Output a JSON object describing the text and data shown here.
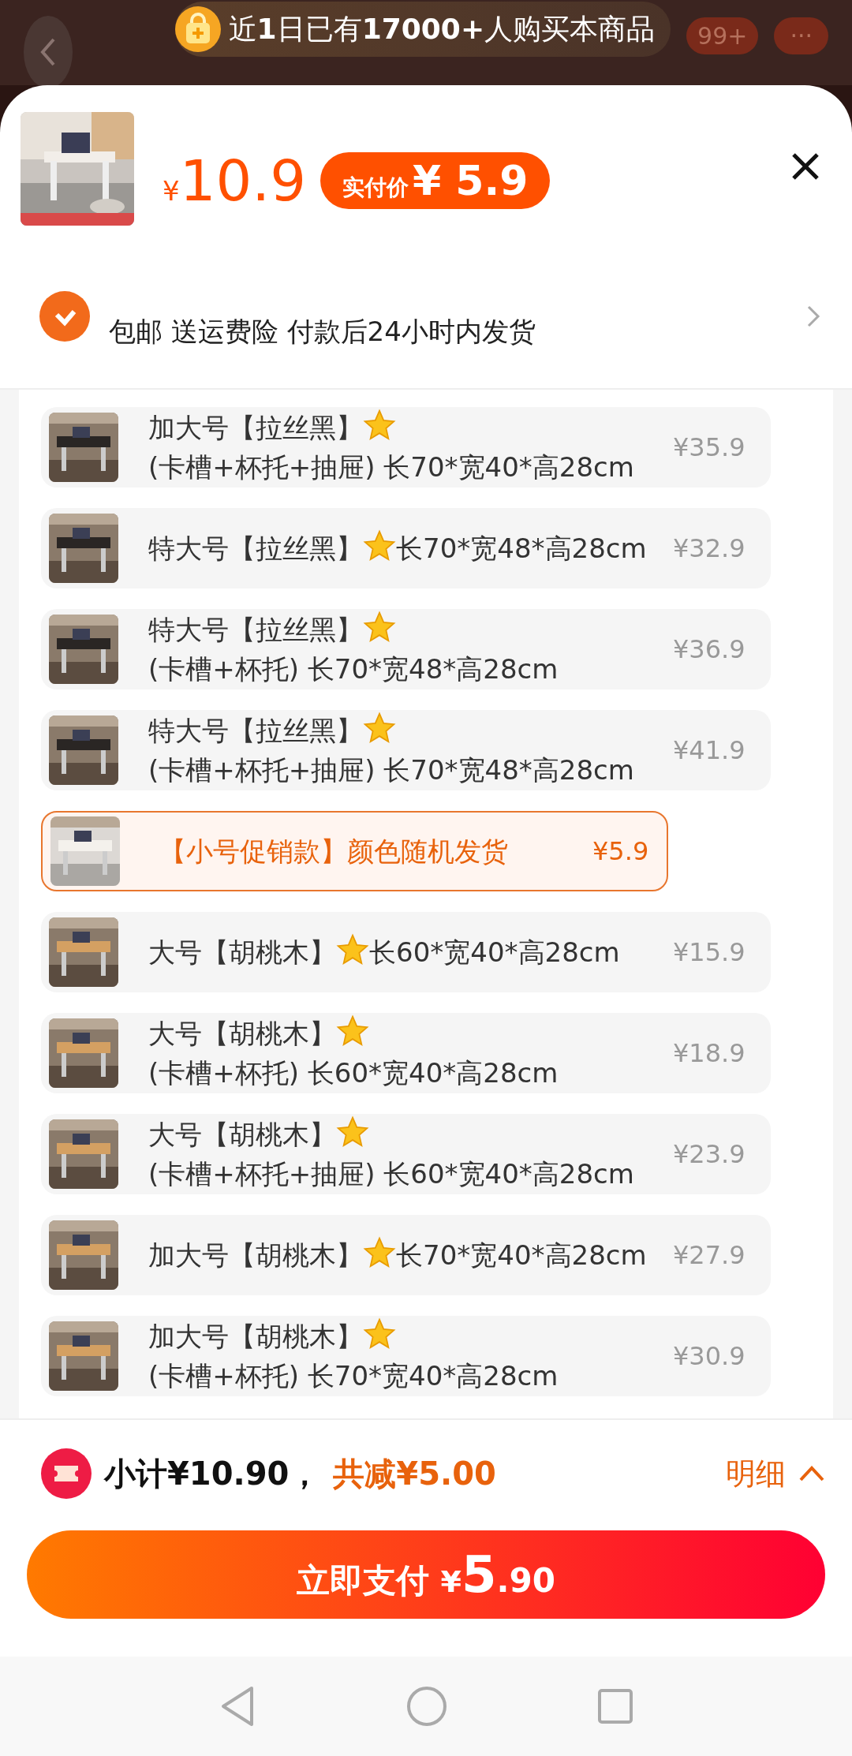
{
  "banner": {
    "text": "近**1**日已有**17000+**人购买本商品"
  },
  "background_header": {
    "cart_badge": "99+",
    "more": "···"
  },
  "product": {
    "price_symbol": "¥",
    "price": "10.9",
    "paid_label": "实付价",
    "paid_price": "¥ 5.9"
  },
  "shipping": {
    "text": "包邮 送运费险 付款后24小时内发货"
  },
  "options": [
    {
      "name": "加大号【拉丝黑】",
      "spec": "(卡槽+杯托+抽屉) 长70*宽40*高28cm",
      "price": "¥35.9",
      "selected": false
    },
    {
      "name": "特大号【拉丝黑】",
      "spec": "长70*宽48*高28cm",
      "price": "¥32.9",
      "selected": false
    },
    {
      "name": "特大号【拉丝黑】",
      "spec": "(卡槽+杯托) 长70*宽48*高28cm",
      "price": "¥36.9",
      "selected": false
    },
    {
      "name": "特大号【拉丝黑】",
      "spec": "(卡槽+杯托+抽屉) 长70*宽48*高28cm",
      "price": "¥41.9",
      "selected": false
    },
    {
      "name": "【小号促销款】颜色随机发货",
      "price": "¥5.9",
      "selected": true
    },
    {
      "name": "大号【胡桃木】",
      "spec": "长60*宽40*高28cm",
      "price": "¥15.9",
      "selected": false
    },
    {
      "name": "大号【胡桃木】",
      "spec": "(卡槽+杯托) 长60*宽40*高28cm",
      "price": "¥18.9",
      "selected": false
    },
    {
      "name": "大号【胡桃木】",
      "spec": "(卡槽+杯托+抽屉) 长60*宽40*高28cm",
      "price": "¥23.9",
      "selected": false
    },
    {
      "name": "加大号【胡桃木】",
      "spec": "长70*宽40*高28cm",
      "price": "¥27.9",
      "selected": false
    },
    {
      "name": "加大号【胡桃木】",
      "spec": "(卡槽+杯托) 长70*宽40*高28cm",
      "price": "¥30.9",
      "selected": false
    }
  ],
  "summary": {
    "subtotal": "小计¥10.90，",
    "discount": "共减¥5.00",
    "details": "明细"
  },
  "pay_button": {
    "label": "立即支付",
    "currency": "¥",
    "amount_int": "5",
    "amount_dec": ".90"
  }
}
